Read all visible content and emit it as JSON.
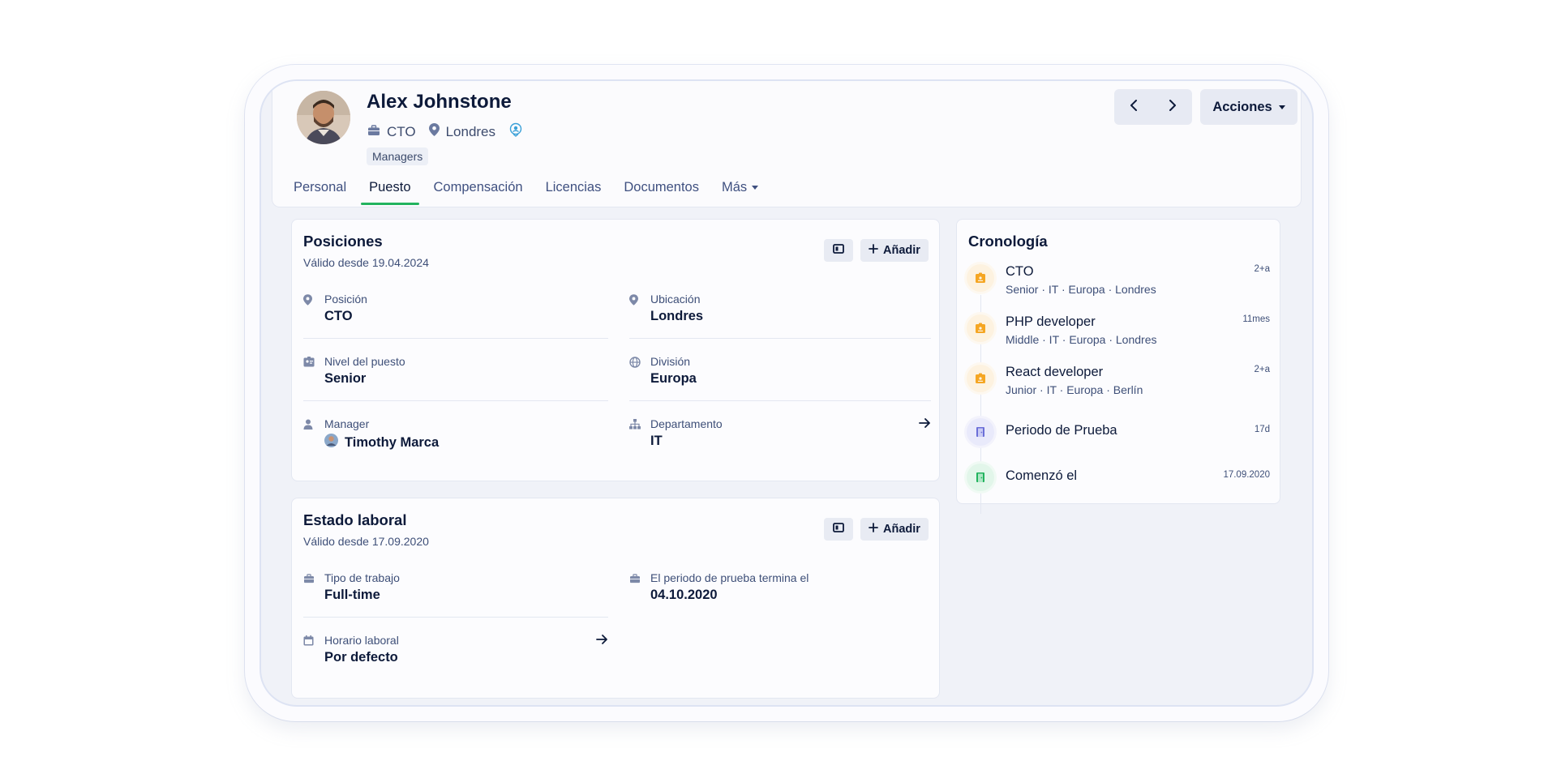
{
  "profile": {
    "name": "Alex Johnstone",
    "role": "CTO",
    "location": "Londres",
    "badge": "Managers",
    "icons": {
      "role": "briefcase-icon",
      "location": "map-pin-icon",
      "extra": "id-badge-icon"
    }
  },
  "tabs": [
    {
      "label": "Personal",
      "active": false
    },
    {
      "label": "Puesto",
      "active": true
    },
    {
      "label": "Compensación",
      "active": false
    },
    {
      "label": "Licencias",
      "active": false
    },
    {
      "label": "Documentos",
      "active": false
    },
    {
      "label": "Más",
      "active": false,
      "has_dropdown": true
    }
  ],
  "header_actions": {
    "actions_label": "Acciones"
  },
  "positions": {
    "title": "Posiciones",
    "subtitle": "Válido desde 19.04.2024",
    "add_label": "Añadir",
    "fields": [
      {
        "label": "Posición",
        "value": "CTO",
        "icon": "map-pin-icon"
      },
      {
        "label": "Ubicación",
        "value": "Londres",
        "icon": "map-pin-icon"
      },
      {
        "label": "Nivel del puesto",
        "value": "Senior",
        "icon": "id-card-icon"
      },
      {
        "label": "División",
        "value": "Europa",
        "icon": "globe-icon"
      },
      {
        "label": "Manager",
        "value": "Timothy Marca",
        "icon": "user-icon"
      },
      {
        "label": "Departamento",
        "value": "IT",
        "icon": "hierarchy-icon"
      }
    ]
  },
  "employment": {
    "title": "Estado laboral",
    "subtitle": "Válido desde 17.09.2020",
    "add_label": "Añadir",
    "fields": [
      {
        "label": "Tipo de trabajo",
        "value": "Full-time",
        "icon": "briefcase-icon"
      },
      {
        "label": "El periodo de prueba termina el",
        "value": "04.10.2020",
        "icon": "briefcase-icon"
      },
      {
        "label": "Horario laboral",
        "value": "Por defecto",
        "icon": "calendar-icon"
      }
    ]
  },
  "timeline": {
    "title": "Cronología",
    "items": [
      {
        "title": "CTO",
        "subtitle": "Senior · IT · Europa · Londres",
        "time": "2+a",
        "icon": "badge-icon",
        "color": "#f5a623"
      },
      {
        "title": "PHP developer",
        "subtitle": "Middle · IT · Europa · Londres",
        "time": "11mes",
        "icon": "badge-icon",
        "color": "#f5a623"
      },
      {
        "title": "React developer",
        "subtitle": "Junior · IT · Europa · Berlín",
        "time": "2+a",
        "icon": "badge-icon",
        "color": "#f5a623"
      },
      {
        "title": "Periodo de Prueba",
        "subtitle": "",
        "time": "17d",
        "icon": "door-icon",
        "color": "#6b6fd8"
      },
      {
        "title": "Comenzó el",
        "subtitle": "",
        "time": "17.09.2020",
        "icon": "door-icon",
        "color": "#22b35e"
      }
    ]
  },
  "colors": {
    "accent_green": "#22b35e",
    "badge_orange": "#f5a623",
    "probation_purple": "#6b6fd8"
  }
}
